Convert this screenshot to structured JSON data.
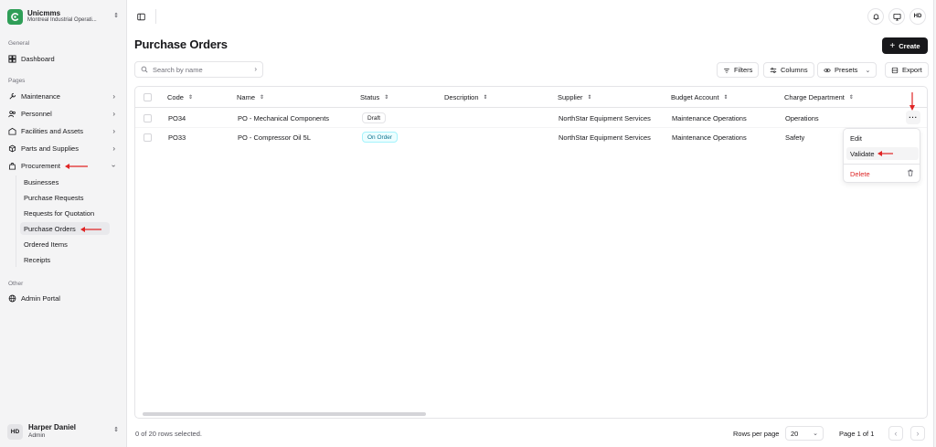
{
  "org": {
    "name": "Unicmms",
    "subtitle": "Montreal Industrial Operati..."
  },
  "sidebar": {
    "general_label": "General",
    "dashboard": "Dashboard",
    "pages_label": "Pages",
    "items": [
      {
        "label": "Maintenance",
        "icon": "wrench-icon"
      },
      {
        "label": "Personnel",
        "icon": "users-icon"
      },
      {
        "label": "Facilities and Assets",
        "icon": "building-icon"
      },
      {
        "label": "Parts and Supplies",
        "icon": "package-icon"
      },
      {
        "label": "Procurement",
        "icon": "shopping-bag-icon"
      }
    ],
    "procurement_sub": [
      "Businesses",
      "Purchase Requests",
      "Requests for Quotation",
      "Purchase Orders",
      "Ordered Items",
      "Receipts"
    ],
    "other_label": "Other",
    "admin_portal": "Admin Portal"
  },
  "user": {
    "initials": "HD",
    "name": "Harper Daniel",
    "role": "Admin"
  },
  "topbar": {
    "user_initials": "HD"
  },
  "page": {
    "title": "Purchase Orders",
    "create_label": "Create"
  },
  "search": {
    "placeholder": "Search by name"
  },
  "toolbar": {
    "filters": "Filters",
    "columns": "Columns",
    "presets": "Presets",
    "export": "Export"
  },
  "table": {
    "headers": [
      "Code",
      "Name",
      "Status",
      "Description",
      "Supplier",
      "Budget Account",
      "Charge Department"
    ],
    "rows": [
      {
        "code": "PO34",
        "name": "PO - Mechanical Components",
        "status": "Draft",
        "description": "",
        "supplier": "NorthStar Equipment Services",
        "budget": "Maintenance Operations",
        "department": "Operations"
      },
      {
        "code": "PO33",
        "name": "PO - Compressor Oil 5L",
        "status": "On Order",
        "description": "",
        "supplier": "NorthStar Equipment Services",
        "budget": "Maintenance Operations",
        "department": "Safety"
      }
    ]
  },
  "row_menu": {
    "trigger": "···",
    "edit": "Edit",
    "validate": "Validate",
    "delete": "Delete"
  },
  "footer": {
    "selected": "0 of 20 rows selected.",
    "rows_per_page_label": "Rows per page",
    "rows_per_page": "20",
    "page": "Page 1 of 1"
  },
  "colors": {
    "brand": "#2f9e57",
    "annotation": "#e02424",
    "danger": "#dc2626",
    "on_order": "#0e7490"
  }
}
